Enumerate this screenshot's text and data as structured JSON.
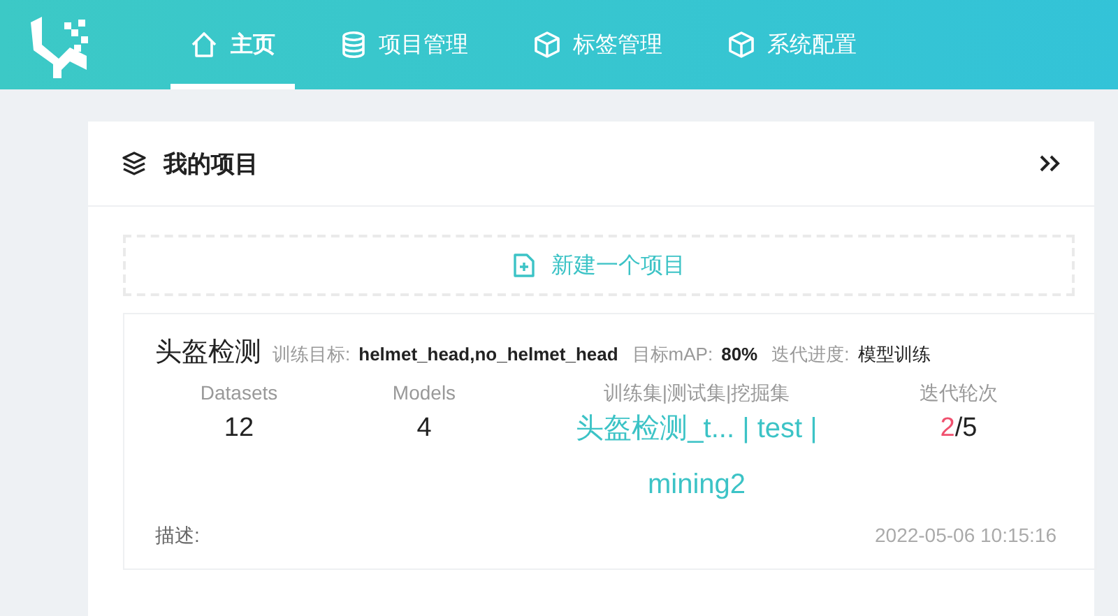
{
  "nav": {
    "tabs": [
      {
        "label": "主页",
        "selected": true
      },
      {
        "label": "项目管理",
        "selected": false
      },
      {
        "label": "标签管理",
        "selected": false
      },
      {
        "label": "系统配置",
        "selected": false
      }
    ]
  },
  "panel": {
    "title": "我的项目",
    "new_project": "新建一个项目",
    "project": {
      "name": "头盔检测",
      "meta": [
        {
          "label": "训练目标:",
          "value": "helmet_head,no_helmet_head"
        },
        {
          "label": "目标mAP:",
          "value": "80%"
        },
        {
          "label": "迭代进度:",
          "value": "模型训练"
        }
      ],
      "stats": [
        {
          "kind": "count",
          "label": "Datasets",
          "value": "12"
        },
        {
          "kind": "count",
          "label": "Models",
          "value": "4"
        },
        {
          "kind": "sets",
          "label": "训练集|测试集|挖掘集",
          "value": "头盔检测_t... | test | mining2"
        },
        {
          "kind": "progress",
          "label": "迭代轮次",
          "current": "2",
          "separator": "/",
          "total": "5"
        }
      ],
      "description_label": "描述:",
      "created": "2022-05-06 10:15:16"
    }
  }
}
